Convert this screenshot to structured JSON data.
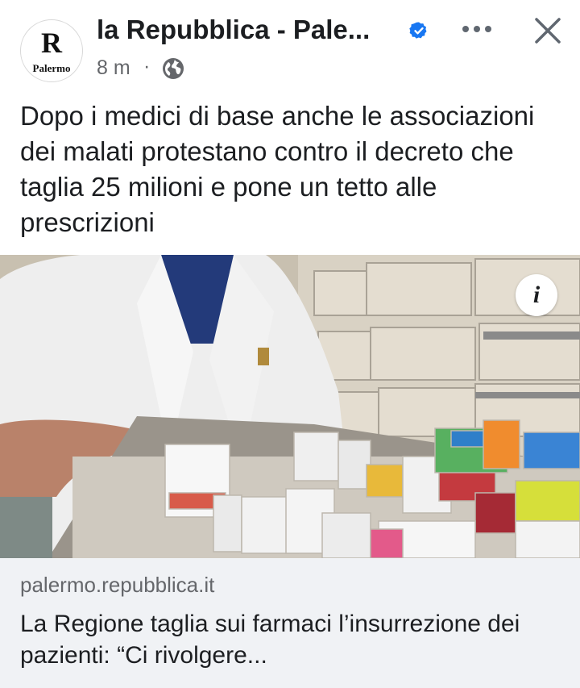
{
  "header": {
    "avatar": {
      "logo_letter": "R",
      "logo_city": "Palermo"
    },
    "page_name": "la Repubblica - Pale...",
    "verified_icon": "verified-badge-icon",
    "timestamp": "8 m",
    "separator": "·",
    "audience_icon": "globe-icon",
    "more_icon": "more-options-icon",
    "close_icon": "close-icon"
  },
  "post": {
    "text": "Dopo i medici di base anche le associazioni dei malati protestano contro il decreto che taglia 25 milioni e pone un tetto alle prescrizioni"
  },
  "image": {
    "info_icon": "info-icon",
    "info_label": "i"
  },
  "link_preview": {
    "domain": "palermo.repubblica.it",
    "title": "La Regione taglia sui farmaci l’insurrezione dei pazienti: “Ci rivolgere..."
  },
  "colors": {
    "verified": "#1877f2",
    "secondary_text": "#65676b",
    "link_bg": "#f0f2f5"
  }
}
